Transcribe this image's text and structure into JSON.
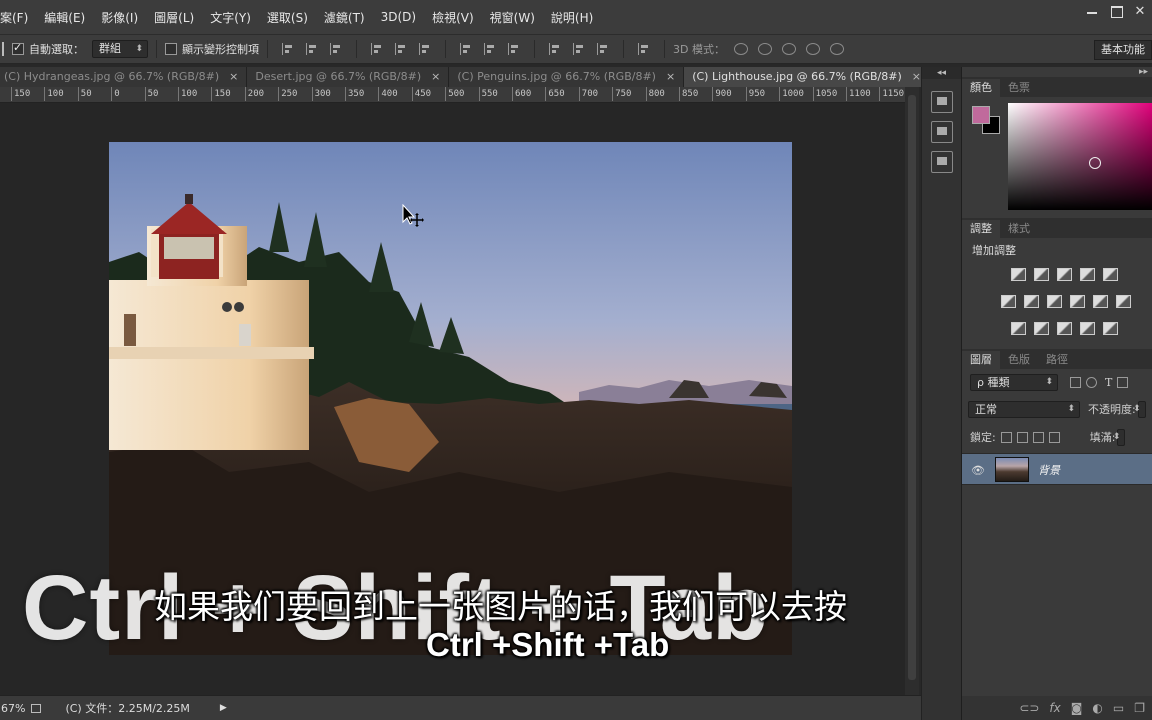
{
  "menubar": {
    "items": [
      "案(F)",
      "編輯(E)",
      "影像(I)",
      "圖層(L)",
      "文字(Y)",
      "選取(S)",
      "濾鏡(T)",
      "3D(D)",
      "檢視(V)",
      "視窗(W)",
      "說明(H)"
    ]
  },
  "options": {
    "auto_select_label": "自動選取：",
    "auto_select_checked": true,
    "auto_select_value": "群組",
    "show_transform_label": "顯示變形控制項",
    "show_transform_checked": false,
    "mode3d_label": "3D 模式：",
    "workspace_label": "基本功能"
  },
  "tabs": [
    {
      "label": "(C) Hydrangeas.jpg @ 66.7% (RGB/8#)",
      "close": "×"
    },
    {
      "label": "Desert.jpg @ 66.7% (RGB/8#)",
      "close": "×"
    },
    {
      "label": "(C) Penguins.jpg @ 66.7% (RGB/8#)",
      "close": "×"
    },
    {
      "label": "(C) Lighthouse.jpg @ 66.7% (RGB/8#)",
      "close": "×"
    }
  ],
  "ruler_ticks": [
    "150",
    "100",
    "50",
    "0",
    "50",
    "100",
    "150",
    "200",
    "250",
    "300",
    "350",
    "400",
    "450",
    "500",
    "550",
    "600",
    "650",
    "700",
    "750",
    "800",
    "850",
    "900",
    "950",
    "1000",
    "1050",
    "1100",
    "1150"
  ],
  "color_panel": {
    "tabs": [
      "顏色",
      "色票"
    ],
    "foreground_color": "#c06a9c",
    "background_color": "#000000"
  },
  "adjust_panel": {
    "tabs": [
      "調整",
      "樣式"
    ],
    "title": "增加調整"
  },
  "layers_panel": {
    "tabs": [
      "圖層",
      "色版",
      "路徑"
    ],
    "filter": "種類",
    "blend_mode": "正常",
    "opacity_label": "不透明度:",
    "lock_label": "鎖定:",
    "fill_label": "填滿:",
    "layer_name": "背景",
    "eye": "👁"
  },
  "status": {
    "zoom": "67%",
    "doc_info": "(C) 文件：2.25M/2.25M"
  },
  "captions": {
    "big": "Ctrl + Shift + Tab",
    "subtitle_cn": "如果我们要回到上一张图片的话，我们可以去按",
    "subtitle_en": "Ctrl +Shift +Tab"
  },
  "iconstrip": {
    "collapse": "◂◂"
  },
  "panel_collapse": "▸▸"
}
